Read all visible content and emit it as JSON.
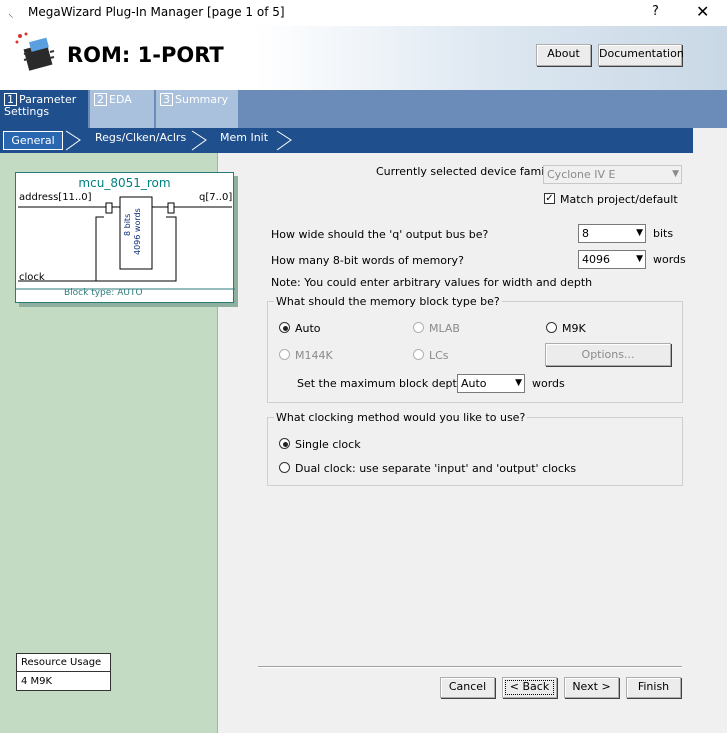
{
  "window": {
    "title": "MegaWizard Plug-In Manager [page 1 of 5]",
    "help_glyph": "?",
    "close_glyph": "✕"
  },
  "header": {
    "title": "ROM: 1-PORT",
    "about_label": "About",
    "documentation_label": "Documentation"
  },
  "tabs": [
    {
      "num": "1",
      "label": "Parameter Settings"
    },
    {
      "num": "2",
      "label": "EDA"
    },
    {
      "num": "3",
      "label": "Summary"
    }
  ],
  "subtabs": [
    "General",
    "Regs/Clken/Aclrs",
    "Mem Init"
  ],
  "symbol": {
    "name": "mcu_8051_rom",
    "address_port": "address[11..0]",
    "q_port": "q[7..0]",
    "clock_port": "clock",
    "mem_bits": "8 bits",
    "mem_words": "4096 words",
    "block_type": "Block type: AUTO"
  },
  "resource": {
    "header": "Resource Usage",
    "value": "4 M9K"
  },
  "device": {
    "label": "Currently selected device family:",
    "value": "Cyclone IV E",
    "match_label": "Match project/default",
    "match_checked": true
  },
  "width": {
    "label": "How wide should the 'q' output bus be?",
    "value": "8",
    "unit": "bits"
  },
  "words": {
    "label": "How many 8-bit words of memory?",
    "value": "4096",
    "unit": "words"
  },
  "note": "Note: You could enter arbitrary values for width and depth",
  "memblock": {
    "legend": "What should the memory block type be?",
    "auto": "Auto",
    "mlab": "MLAB",
    "m9k": "M9K",
    "m144k": "M144K",
    "lcs": "LCs",
    "options_label": "Options...",
    "depth_label": "Set the maximum block depth to",
    "depth_value": "Auto",
    "depth_unit": "words"
  },
  "clocking": {
    "legend": "What clocking method would you like to use?",
    "single": "Single clock",
    "dual": "Dual clock: use separate 'input' and 'output' clocks"
  },
  "footer": {
    "cancel": "Cancel",
    "back": "< Back",
    "next": "Next >",
    "finish": "Finish"
  }
}
